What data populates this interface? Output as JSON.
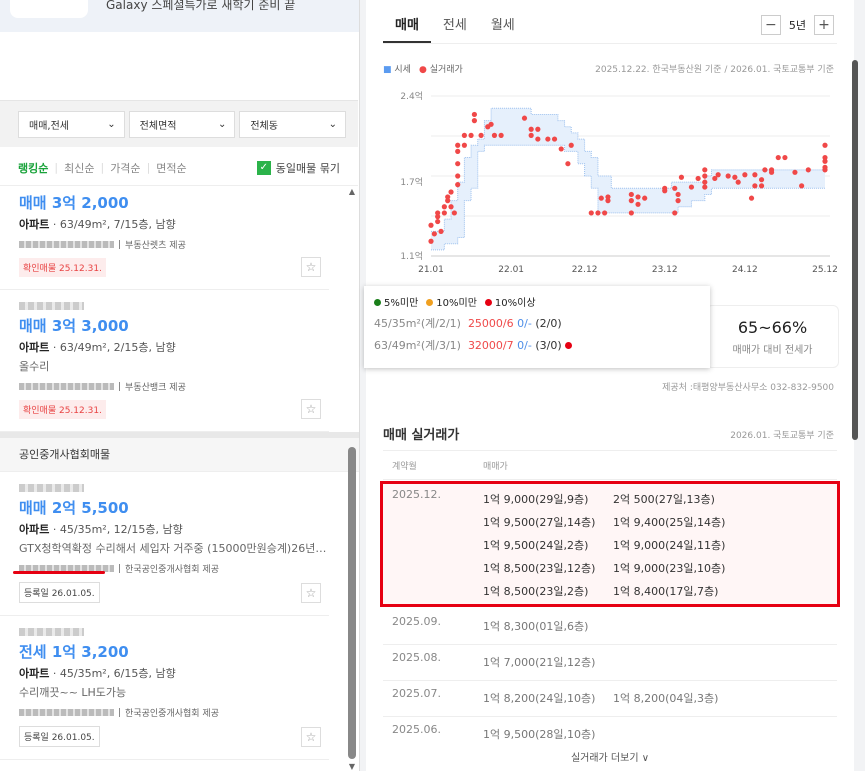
{
  "banner": {
    "text": "Galaxy 스페셜특가로 새학기 준비 끝"
  },
  "filters": [
    {
      "label": "매매,전세"
    },
    {
      "label": "전체면적"
    },
    {
      "label": "전체동"
    }
  ],
  "sort": {
    "options": [
      "랭킹순",
      "최신순",
      "가격순",
      "면적순"
    ],
    "active": "랭킹순",
    "group_label": "동일매물 묶기",
    "group_checked": true
  },
  "listings": [
    {
      "price": "매매 3억 2,000",
      "type": "아파트",
      "spec": " · 63/49m², 7/15층, 남향",
      "desc": "",
      "provider": "부동산렛츠 제공",
      "tag": "확인매물 25.12.31."
    },
    {
      "price": "매매 3억 3,000",
      "type": "아파트",
      "spec": " · 63/49m², 2/15층, 남향",
      "desc": "올수리",
      "provider": "부동산뱅크 제공",
      "tag": "확인매물 25.12.31."
    },
    {
      "price": "매매 2억 5,500",
      "type": "아파트",
      "spec": " · 45/35m², 12/15층, 남향",
      "desc": "GTX청학역확정 수리해서 세입자 거주중 (15000만원승계)26년…",
      "provider": "한국공인중개사협회 제공",
      "tag": "등록일 26.01.05."
    },
    {
      "price": "전세 1억 3,200",
      "type": "아파트",
      "spec": " · 45/35m², 6/15층, 남향",
      "desc": "수리깨끗~~ LH도가능",
      "provider": "한국공인중개사협회 제공",
      "tag": "등록일 26.01.05."
    }
  ],
  "section_header": "공인중개사협회매물",
  "right": {
    "tabs": [
      "매매",
      "전세",
      "월세"
    ],
    "active_tab": "매매",
    "period": "5년",
    "legend": {
      "market": "시세",
      "actual": "실거래가"
    },
    "basis": "2025.12.22. 한국부동산원 기준 / 2026.01. 국토교통부 기준",
    "popup": {
      "legend": [
        {
          "label": "5%미만",
          "color": "#1a7f1a"
        },
        {
          "label": "10%미만",
          "color": "#f0a020"
        },
        {
          "label": "10%이상",
          "color": "#e60012"
        }
      ],
      "rows": [
        {
          "area": "45/35m²(계/2/1)",
          "price": "25000/6",
          "rent": "0/-",
          "count": "(2/0)"
        },
        {
          "area": "63/49m²(계/3/1)",
          "price": "32000/7",
          "rent": "0/-",
          "count": "(3/0)"
        }
      ]
    },
    "ratio": {
      "value": "65~66%",
      "label": "매매가 대비 전세가"
    },
    "provider": "제공처 :태평양부동산사무소 032-832-9500",
    "deals_title": "매매 실거래가",
    "deals_basis": "2026.01. 국토교통부 기준",
    "columns": [
      "계약월",
      "매매가"
    ],
    "deals": [
      {
        "month": "2025.12.",
        "prices": [
          "1억 9,000(29일,9층)",
          "2억 500(27일,13층)",
          "1억 9,500(27일,14층)",
          "1억 9,400(25일,14층)",
          "1억 9,500(24일,2층)",
          "1억 9,000(24일,11층)",
          "1억 8,500(23일,12층)",
          "1억 9,000(23일,10층)",
          "1억 8,500(23일,2층)",
          "1억 8,400(17일,7층)"
        ]
      },
      {
        "month": "2025.09.",
        "prices": [
          "1억 8,300(01일,6층)"
        ]
      },
      {
        "month": "2025.08.",
        "prices": [
          "1억 7,000(21일,12층)"
        ]
      },
      {
        "month": "2025.07.",
        "prices": [
          "1억 8,200(24일,10층)",
          "1억 8,200(04일,3층)"
        ]
      },
      {
        "month": "2025.06.",
        "prices": [
          "1억 9,500(28일,10층)"
        ]
      }
    ],
    "more": "실거래가 더보기 ∨"
  },
  "chart_data": {
    "type": "scatter",
    "title": "",
    "xlabel": "",
    "ylabel": "",
    "x_unit": "months since 21.01",
    "ylim": [
      1.1,
      2.4
    ],
    "xlim": [
      0,
      59
    ],
    "y_ticks": [
      {
        "v": 2.4,
        "label": "2.4억"
      },
      {
        "v": 1.7,
        "label": "1.7억"
      },
      {
        "v": 1.1,
        "label": "1.1억"
      }
    ],
    "x_ticks": [
      {
        "v": 0,
        "label": "21.01"
      },
      {
        "v": 12,
        "label": "22.01"
      },
      {
        "v": 23,
        "label": "22.12"
      },
      {
        "v": 35,
        "label": "23.12"
      },
      {
        "v": 47,
        "label": "24.12"
      },
      {
        "v": 59,
        "label": "25.12"
      }
    ],
    "colors": {
      "band": "#e6f0fc",
      "band_line": "#9cc0ee",
      "point": "#f04848"
    },
    "band_upper": [
      [
        0,
        1.3
      ],
      [
        2,
        1.4
      ],
      [
        3,
        1.55
      ],
      [
        4,
        1.7
      ],
      [
        5,
        1.9
      ],
      [
        6,
        2.0
      ],
      [
        7,
        2.05
      ],
      [
        8,
        2.2
      ],
      [
        9,
        2.3
      ],
      [
        14,
        2.3
      ],
      [
        15,
        2.25
      ],
      [
        19,
        2.2
      ],
      [
        20,
        2.15
      ],
      [
        21,
        2.1
      ],
      [
        22,
        2.05
      ],
      [
        23,
        1.95
      ],
      [
        24,
        1.9
      ],
      [
        25,
        1.75
      ],
      [
        27,
        1.65
      ],
      [
        35,
        1.65
      ],
      [
        36,
        1.7
      ],
      [
        41,
        1.75
      ],
      [
        42,
        1.8
      ],
      [
        59,
        1.8
      ]
    ],
    "band_lower": [
      [
        0,
        1.15
      ],
      [
        2,
        1.2
      ],
      [
        4,
        1.25
      ],
      [
        5,
        1.55
      ],
      [
        6,
        1.65
      ],
      [
        7,
        1.95
      ],
      [
        8,
        2.0
      ],
      [
        20,
        1.95
      ],
      [
        22,
        1.85
      ],
      [
        23,
        1.75
      ],
      [
        24,
        1.65
      ],
      [
        25,
        1.45
      ],
      [
        36,
        1.45
      ],
      [
        37,
        1.5
      ],
      [
        39,
        1.55
      ],
      [
        41,
        1.6
      ],
      [
        42,
        1.65
      ],
      [
        59,
        1.65
      ]
    ],
    "points": [
      [
        0,
        1.22
      ],
      [
        0,
        1.35
      ],
      [
        0.5,
        1.28
      ],
      [
        1,
        1.38
      ],
      [
        1,
        1.42
      ],
      [
        1,
        1.45
      ],
      [
        1.5,
        1.3
      ],
      [
        2,
        1.45
      ],
      [
        2,
        1.5
      ],
      [
        2.5,
        1.55
      ],
      [
        2.5,
        1.58
      ],
      [
        3,
        1.5
      ],
      [
        3,
        1.62
      ],
      [
        3.5,
        1.45
      ],
      [
        4,
        1.68
      ],
      [
        4,
        1.75
      ],
      [
        4,
        1.85
      ],
      [
        4,
        1.95
      ],
      [
        4,
        2.0
      ],
      [
        5,
        2.0
      ],
      [
        5,
        2.08
      ],
      [
        6,
        2.08
      ],
      [
        6.5,
        2.2
      ],
      [
        6.5,
        2.25
      ],
      [
        7.5,
        2.08
      ],
      [
        8.5,
        2.15
      ],
      [
        9,
        2.17
      ],
      [
        9.5,
        2.08
      ],
      [
        10.5,
        2.08
      ],
      [
        14,
        2.22
      ],
      [
        15,
        2.13
      ],
      [
        15,
        2.08
      ],
      [
        16,
        2.13
      ],
      [
        16,
        2.05
      ],
      [
        17.5,
        2.05
      ],
      [
        18.5,
        2.05
      ],
      [
        19.5,
        1.97
      ],
      [
        20.5,
        1.85
      ],
      [
        21,
        2.0
      ],
      [
        24,
        1.45
      ],
      [
        25,
        1.45
      ],
      [
        25.5,
        1.57
      ],
      [
        26,
        1.45
      ],
      [
        26.5,
        1.55
      ],
      [
        26.5,
        1.58
      ],
      [
        30,
        1.45
      ],
      [
        30,
        1.55
      ],
      [
        30,
        1.6
      ],
      [
        31,
        1.58
      ],
      [
        31,
        1.52
      ],
      [
        32,
        1.57
      ],
      [
        35,
        1.63
      ],
      [
        35,
        1.65
      ],
      [
        36.5,
        1.45
      ],
      [
        36.5,
        1.65
      ],
      [
        37,
        1.6
      ],
      [
        37,
        1.55
      ],
      [
        37.5,
        1.74
      ],
      [
        39,
        1.66
      ],
      [
        40,
        1.73
      ],
      [
        41,
        1.7
      ],
      [
        41,
        1.75
      ],
      [
        41,
        1.8
      ],
      [
        41,
        1.66
      ],
      [
        42.5,
        1.73
      ],
      [
        43,
        1.76
      ],
      [
        44.5,
        1.75
      ],
      [
        45.5,
        1.74
      ],
      [
        46,
        1.7
      ],
      [
        47,
        1.76
      ],
      [
        48,
        1.57
      ],
      [
        48.5,
        1.76
      ],
      [
        48.5,
        1.67
      ],
      [
        49.5,
        1.67
      ],
      [
        49.5,
        1.72
      ],
      [
        50,
        1.8
      ],
      [
        51,
        1.78
      ],
      [
        51,
        1.8
      ],
      [
        52,
        1.9
      ],
      [
        53,
        1.9
      ],
      [
        54.5,
        1.78
      ],
      [
        55.5,
        1.67
      ],
      [
        56.5,
        1.8
      ],
      [
        59,
        2.0
      ],
      [
        59,
        1.9
      ],
      [
        59,
        1.87
      ],
      [
        59,
        1.82
      ],
      [
        59,
        1.8
      ]
    ]
  }
}
